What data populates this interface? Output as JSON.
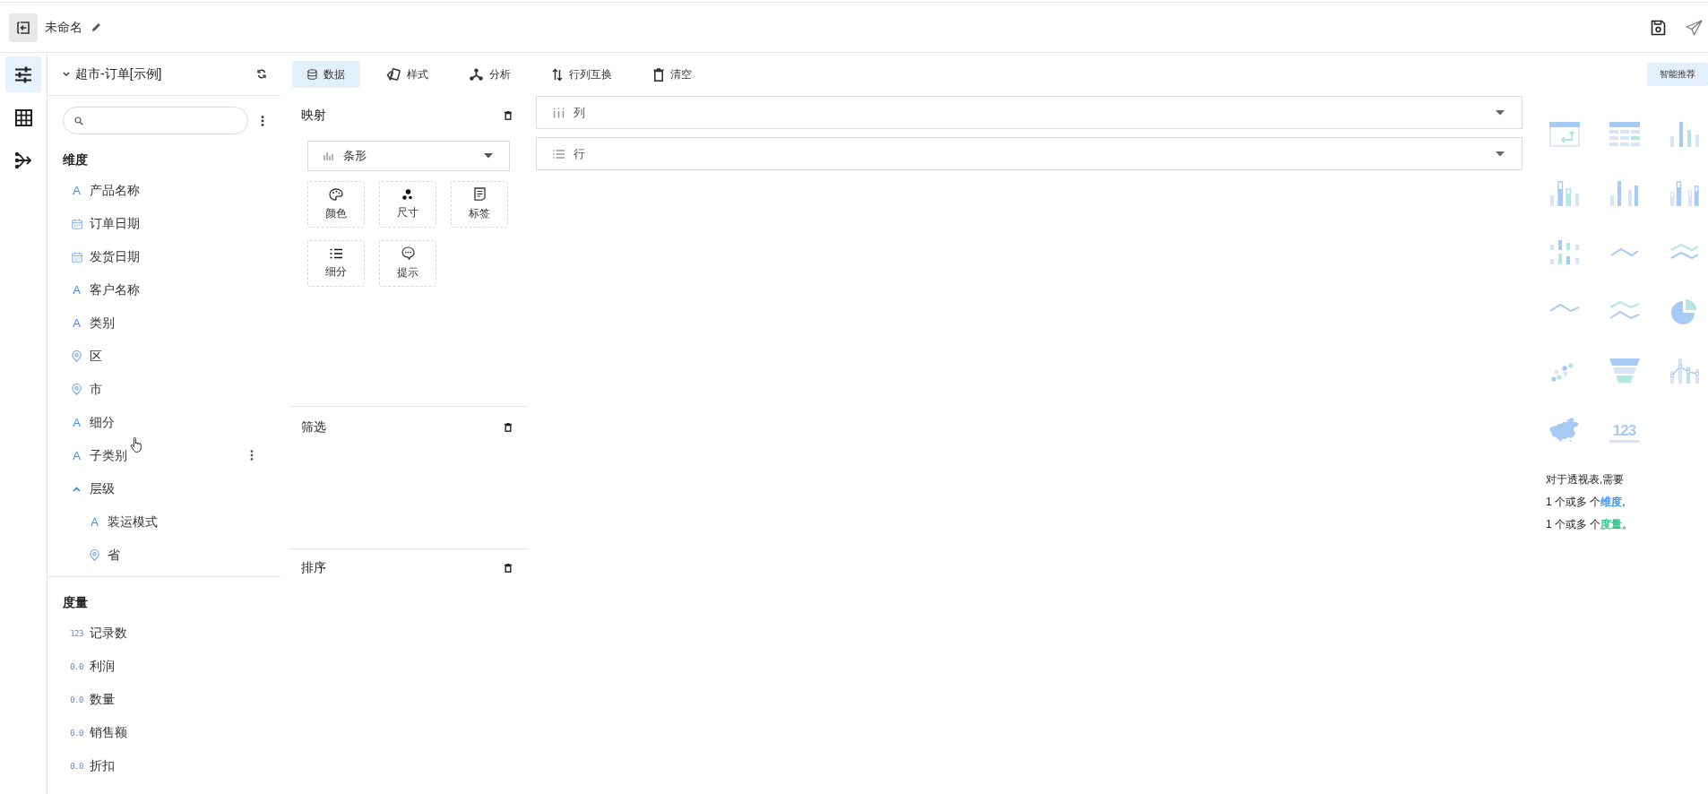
{
  "header": {
    "title": "未命名"
  },
  "rail": [
    {
      "kind": "settings",
      "selected": true
    },
    {
      "kind": "table",
      "selected": false
    },
    {
      "kind": "flow",
      "selected": false
    }
  ],
  "dataset": {
    "name": "超市-订单[示例]"
  },
  "dimensions": {
    "title": "维度",
    "fields": [
      {
        "kind": "text",
        "mark": "A",
        "name": "产品名称",
        "hovered": false
      },
      {
        "kind": "date",
        "name": "订单日期",
        "hovered": false
      },
      {
        "kind": "date",
        "name": "发货日期",
        "hovered": false
      },
      {
        "kind": "text",
        "mark": "A",
        "name": "客户名称",
        "hovered": false
      },
      {
        "kind": "text",
        "mark": "A",
        "name": "类别",
        "hovered": false
      },
      {
        "kind": "geo",
        "name": "区",
        "hovered": false
      },
      {
        "kind": "geo",
        "name": "市",
        "hovered": false
      },
      {
        "kind": "text",
        "mark": "A",
        "name": "细分",
        "hovered": false
      },
      {
        "kind": "text",
        "mark": "A",
        "name": "子类别",
        "hovered": true
      },
      {
        "kind": "hierarchy",
        "name": "层级",
        "expanded": true,
        "hovered": false,
        "children": [
          {
            "kind": "text",
            "mark": "A",
            "name": "装运模式",
            "hovered": false
          },
          {
            "kind": "geo",
            "name": "省",
            "hovered": false
          }
        ]
      }
    ]
  },
  "measures": {
    "title": "度量",
    "fields": [
      {
        "kind": "number",
        "mark": "123",
        "name": "记录数"
      },
      {
        "kind": "number",
        "mark": "0.0",
        "name": "利润"
      },
      {
        "kind": "number",
        "mark": "0.0",
        "name": "数量"
      },
      {
        "kind": "number",
        "mark": "0.0",
        "name": "销售额"
      },
      {
        "kind": "number",
        "mark": "0.0",
        "name": "折扣"
      }
    ]
  },
  "toolbar": {
    "tabs": [
      {
        "label": "数据",
        "selected": true
      },
      {
        "label": "样式",
        "selected": false
      },
      {
        "label": "分析",
        "selected": false
      }
    ],
    "actions": [
      {
        "label": "行列互换"
      },
      {
        "label": "清空"
      }
    ],
    "recommend": "智能推荐"
  },
  "mapping": {
    "title": "映射",
    "chart_type": "条形",
    "slots": [
      {
        "label": "颜色"
      },
      {
        "label": "尺寸"
      },
      {
        "label": "标签"
      },
      {
        "label": "细分"
      },
      {
        "label": "提示"
      }
    ]
  },
  "filter": {
    "title": "筛选"
  },
  "sort": {
    "title": "排序"
  },
  "shelves": [
    {
      "label": "列"
    },
    {
      "label": "行"
    }
  ],
  "gallery": [
    {
      "kind": "pivot"
    },
    {
      "kind": "table"
    },
    {
      "kind": "bar"
    },
    {
      "kind": "stacked"
    },
    {
      "kind": "grouped"
    },
    {
      "kind": "stackedgrouped"
    },
    {
      "kind": "matrix"
    },
    {
      "kind": "line"
    },
    {
      "kind": "multiline"
    },
    {
      "kind": "curve"
    },
    {
      "kind": "multicurve"
    },
    {
      "kind": "pie"
    },
    {
      "kind": "scatter"
    },
    {
      "kind": "funnel"
    },
    {
      "kind": "combo"
    },
    {
      "kind": "map"
    },
    {
      "kind": "number",
      "label": "123"
    }
  ],
  "hint": {
    "lines": [
      [
        {
          "text": "对于透视表,需要"
        }
      ],
      [
        {
          "text": "1 个或多 个"
        },
        {
          "text": "维度",
          "color": "#3b8ff3"
        },
        {
          "text": ","
        }
      ],
      [
        {
          "text": "1 个或多 个"
        },
        {
          "text": "度量。",
          "color": "#2ec086"
        }
      ]
    ]
  }
}
